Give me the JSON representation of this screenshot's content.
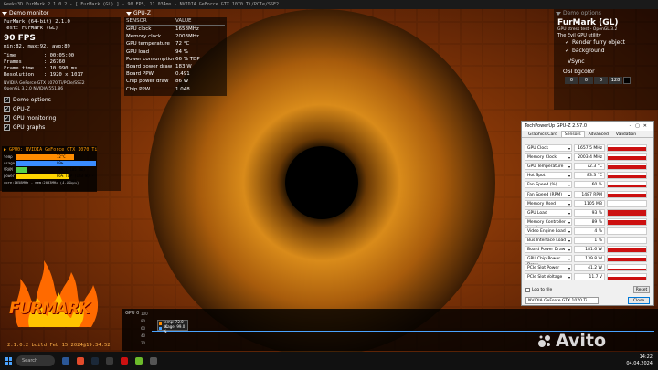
{
  "window": {
    "title": "Geeks3D FurMark 2.1.0.2 - [ FurMark (GL) ] - 90 FPS, 11.034ms - NVIDIA GeForce GTX 1070 Ti/PCIe/SSE2"
  },
  "demo_tabs": {
    "left": "Demo monitor",
    "mid": "GPU-Z",
    "right": "Demo options"
  },
  "left_panel": {
    "line1": "FurMark (64-bit) 2.1.0",
    "line2": "Test: FurMark (GL)",
    "fps": "90 FPS",
    "minmax": "min:82, max:92, avg:89",
    "stats": [
      {
        "label": "Time",
        "value": ": 00:05:00"
      },
      {
        "label": "Frames",
        "value": ": 26760"
      },
      {
        "label": "Frame time",
        "value": ": 10.990 ms"
      },
      {
        "label": "Resolution",
        "value": ": 1920 x 1017"
      }
    ],
    "gpu_name": "NVIDIA GeForce GTX 1070 Ti/PCIe/SSE2",
    "driver": "OpenGL 3.2.0 NVIDIA 551.86",
    "options": [
      "Demo options",
      "GPU-Z",
      "GPU monitoring",
      "GPU graphs"
    ]
  },
  "gpu_monitor": {
    "title": "GPU0: NVIDIA GeForce GTX 1070 Ti",
    "rows": [
      {
        "label": "temp",
        "value": "72°C",
        "fraction": 0.72,
        "color": "#ff8c00"
      },
      {
        "label": "usage",
        "value": "99%",
        "fraction": 0.99,
        "color": "#3a8cff"
      },
      {
        "label": "VRAM",
        "value": "14% (1105 MB)",
        "fraction": 0.14,
        "color": "#5ad14a"
      },
      {
        "label": "power",
        "value": "66% TDP (183 W) - PPW:0.491",
        "fraction": 0.66,
        "color": "#ffd400"
      }
    ],
    "footer": "core:1658MHz - mem:2003MHz (4.0Gbps)"
  },
  "gpuz_overlay": {
    "header_sensor": "SENSOR",
    "header_value": "VALUE",
    "rows": [
      {
        "sensor": "GPU clock",
        "value": "1658MHz"
      },
      {
        "sensor": "Memory clock",
        "value": "2003MHz"
      },
      {
        "sensor": "GPU temperature",
        "value": "72 °C"
      },
      {
        "sensor": "GPU load",
        "value": "94 %"
      },
      {
        "sensor": "Power consumption",
        "value": "66 % TDP"
      },
      {
        "sensor": "Board power draw",
        "value": "183 W"
      },
      {
        "sensor": "Board PPW",
        "value": "0.491"
      },
      {
        "sensor": "Chip power draw",
        "value": "86 W"
      },
      {
        "sensor": "Chip PPW",
        "value": "1.048"
      }
    ]
  },
  "right_panel": {
    "title": "FurMark (GL)",
    "sub1": "GPU stress test - OpenGL 3.2",
    "sub2": "The Evil GPU utility",
    "opt1": "Render furry object",
    "opt2": "background",
    "vsync": "VSync",
    "bgcolor": "OSI bgcolor",
    "rgba": [
      "0",
      "0",
      "0",
      "128"
    ]
  },
  "gpuz_window": {
    "title": "TechPowerUp GPU-Z 2.57.0",
    "tabs": [
      "Graphics Card",
      "Sensors",
      "Advanced",
      "Validation"
    ],
    "rows": [
      {
        "sensor": "GPU Clock",
        "value": "1657.5 MHz",
        "level": 0.7
      },
      {
        "sensor": "Memory Clock",
        "value": "2003.4 MHz",
        "level": 0.7
      },
      {
        "sensor": "GPU Temperature",
        "value": "72.3 °C",
        "level": 0.7
      },
      {
        "sensor": "Hot Spot",
        "value": "83.3 °C",
        "level": 0.6
      },
      {
        "sensor": "Fan Speed (%)",
        "value": "60 %",
        "level": 0.6
      },
      {
        "sensor": "Fan Speed (RPM)",
        "value": "1487 RPM",
        "level": 0.6
      },
      {
        "sensor": "Memory Used",
        "value": "1105 MB",
        "level": 0.15
      },
      {
        "sensor": "GPU Load",
        "value": "93 %",
        "level": 0.9
      },
      {
        "sensor": "Memory Controller Load",
        "value": "89 %",
        "level": 0.85
      },
      {
        "sensor": "Video Engine Load",
        "value": "4 %",
        "level": 0.0
      },
      {
        "sensor": "Bus Interface Load",
        "value": "1 %",
        "level": 0.0
      },
      {
        "sensor": "Board Power Draw",
        "value": "181.6 W",
        "level": 0.7
      },
      {
        "sensor": "GPU Chip Power Draw",
        "value": "139.8 W",
        "level": 0.7
      },
      {
        "sensor": "PCIe Slot Power",
        "value": "41.2 W",
        "level": 0.4
      },
      {
        "sensor": "PCIe Slot Voltage",
        "value": "11.7 V",
        "level": 0.5
      }
    ],
    "log_label": "Log to file",
    "reset": "Reset",
    "device": "NVIDIA GeForce GTX 1070 Ti",
    "close": "Close"
  },
  "graph": {
    "title": "GPU 0",
    "ticks": [
      "100",
      "80",
      "60",
      "40",
      "20"
    ],
    "legend": [
      {
        "label": "temp: 72.0 °C",
        "color": "#ff8c00"
      },
      {
        "label": "usage: 99.0 %",
        "color": "#4aa3ff"
      }
    ]
  },
  "branding": {
    "logo": "FURMARK",
    "version": "2.1.0.2 build Feb 15 2024@19:34:52",
    "watermark": "Avito"
  },
  "taskbar": {
    "search": "Search",
    "time": "14:22",
    "date": "04.04.2024"
  }
}
